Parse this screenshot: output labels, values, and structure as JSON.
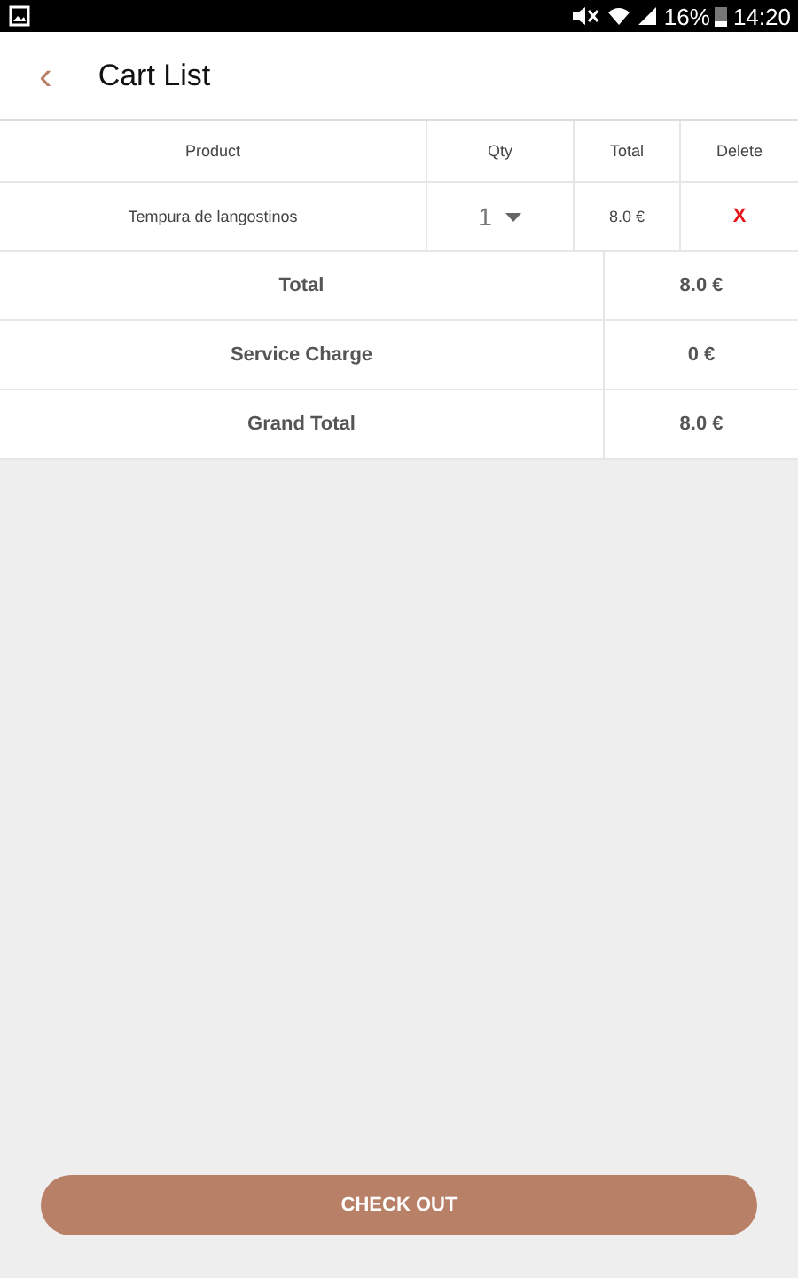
{
  "status_bar": {
    "battery": "16%",
    "time": "14:20"
  },
  "header": {
    "back": "‹",
    "title": "Cart List"
  },
  "table": {
    "columns": [
      "Product",
      "Qty",
      "Total",
      "Delete"
    ],
    "rows": [
      {
        "product": "Tempura de langostinos",
        "qty": "1",
        "total": "8.0 €",
        "delete": "X"
      }
    ]
  },
  "summary": [
    {
      "label": "Total",
      "value": "8.0 €"
    },
    {
      "label": "Service Charge",
      "value": "0 €"
    },
    {
      "label": "Grand Total",
      "value": "8.0 €"
    }
  ],
  "checkout": "CHECK OUT"
}
